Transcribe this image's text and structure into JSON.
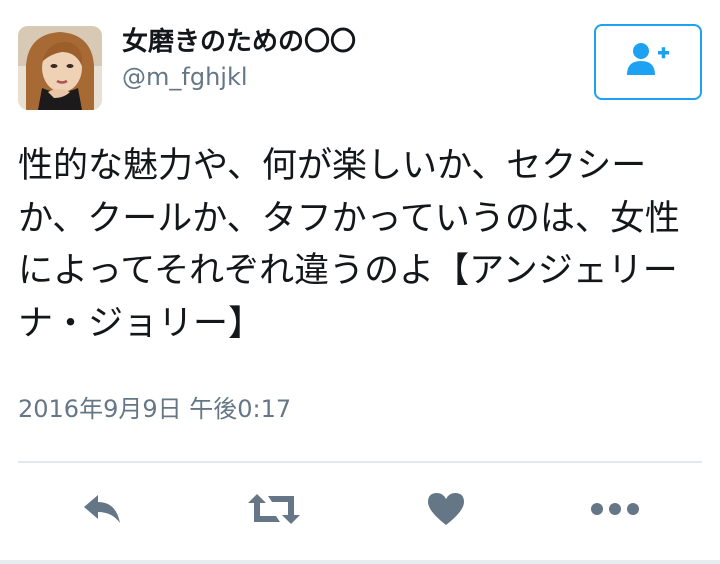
{
  "user": {
    "display_name": "女磨きのための〇〇",
    "handle": "@m_fghjkl"
  },
  "follow_button": {
    "icon": "add-user-icon"
  },
  "tweet": {
    "text": "性的な魅力や、何が楽しいか、セクシーか、クールか、タフかっていうのは、女性によってそれぞれ違うのよ【アンジェリーナ・ジョリー】",
    "timestamp": "2016年9月9日 午後0:17"
  },
  "actions": [
    {
      "name": "reply",
      "icon": "reply-icon"
    },
    {
      "name": "retweet",
      "icon": "retweet-icon"
    },
    {
      "name": "like",
      "icon": "heart-icon"
    },
    {
      "name": "more",
      "icon": "more-icon"
    }
  ],
  "colors": {
    "accent": "#1da1f2",
    "icon_gray": "#657786",
    "divider": "#e1e8ed",
    "text": "#14171a"
  }
}
